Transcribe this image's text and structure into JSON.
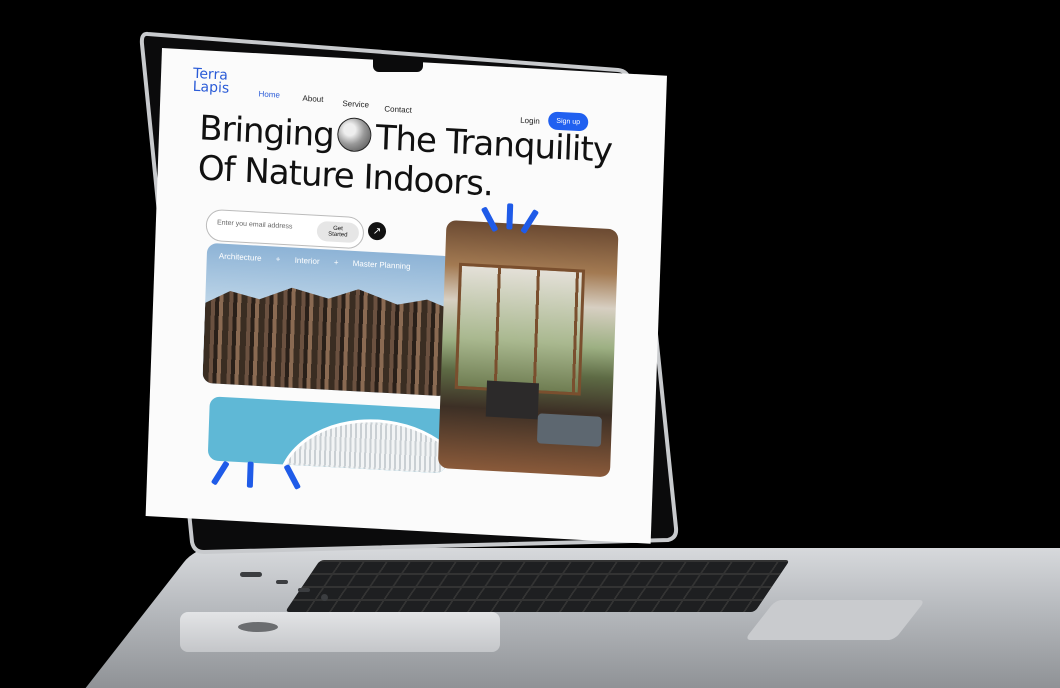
{
  "brand": {
    "line1": "Terra",
    "line2": "Lapis",
    "accent": "#2a5bd7"
  },
  "nav": {
    "items": [
      {
        "label": "Home",
        "active": true
      },
      {
        "label": "About"
      },
      {
        "label": "Service"
      },
      {
        "label": "Contact"
      }
    ],
    "login_label": "Login",
    "signup_label": "Sign up"
  },
  "hero": {
    "line1_a": "Bringing",
    "line1_b": "The Tranquility",
    "line2": "Of Nature Indoors."
  },
  "signup_form": {
    "email_placeholder": "Enter you email address",
    "cta_label": "Get Started"
  },
  "tags": [
    "Architecture",
    "+",
    "Interior",
    "+",
    "Master Planning"
  ],
  "colors": {
    "primary_button": "#2060f0",
    "ray_blue": "#1f5be8"
  },
  "icons": {
    "arrow_button": "arrow-up-right-icon",
    "hero_globe": "globe-image"
  }
}
